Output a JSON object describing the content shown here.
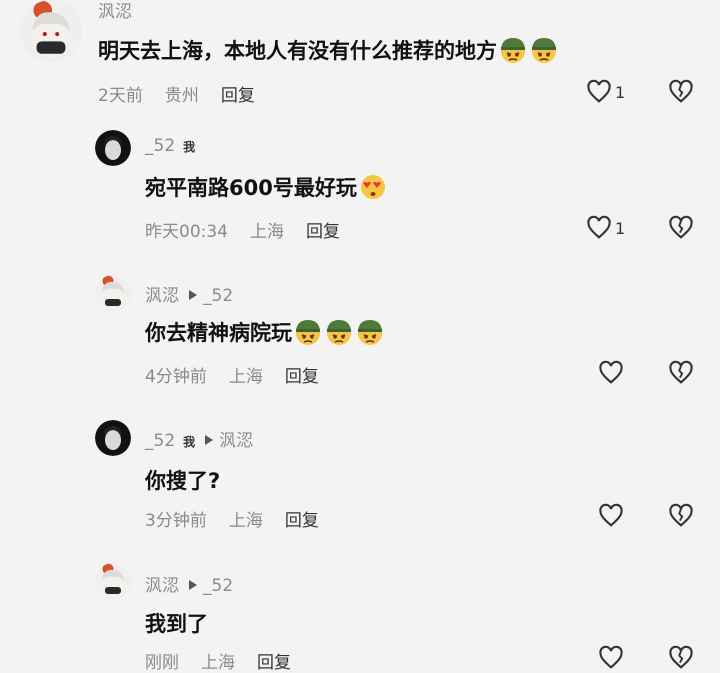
{
  "comments": [
    {
      "user": "沨涊",
      "text": "明天去上海，本地人有没有什么推荐的地方",
      "emojis": [
        "soldier-face-emoji",
        "soldier-face-emoji"
      ],
      "time": "2天前",
      "location": "贵州",
      "reply_label": "回复",
      "like_count": "1"
    },
    {
      "user": "_52",
      "badge": "我",
      "text": "宛平南路600号最好玩",
      "emojis": [
        "heart-eyes-emoji"
      ],
      "time": "昨天00:34",
      "location": "上海",
      "reply_label": "回复",
      "like_count": "1"
    },
    {
      "user": "沨涊",
      "reply_to": "_52",
      "text": "你去精神病院玩",
      "emojis": [
        "soldier-face-emoji",
        "soldier-face-emoji",
        "soldier-face-emoji"
      ],
      "time": "4分钟前",
      "location": "上海",
      "reply_label": "回复"
    },
    {
      "user": "_52",
      "badge": "我",
      "reply_to": "沨涊",
      "text": "你搜了?",
      "time": "3分钟前",
      "location": "上海",
      "reply_label": "回复"
    },
    {
      "user": "沨涊",
      "reply_to": "_52",
      "text": "我到了",
      "time": "刚刚",
      "location": "上海",
      "reply_label": "回复"
    }
  ],
  "icons": {
    "like": "heart-outline-icon",
    "dislike": "broken-heart-icon"
  },
  "colors": {
    "background": "#f3f3f3",
    "meta_text": "#8a8a8a",
    "body_text": "#111111"
  }
}
